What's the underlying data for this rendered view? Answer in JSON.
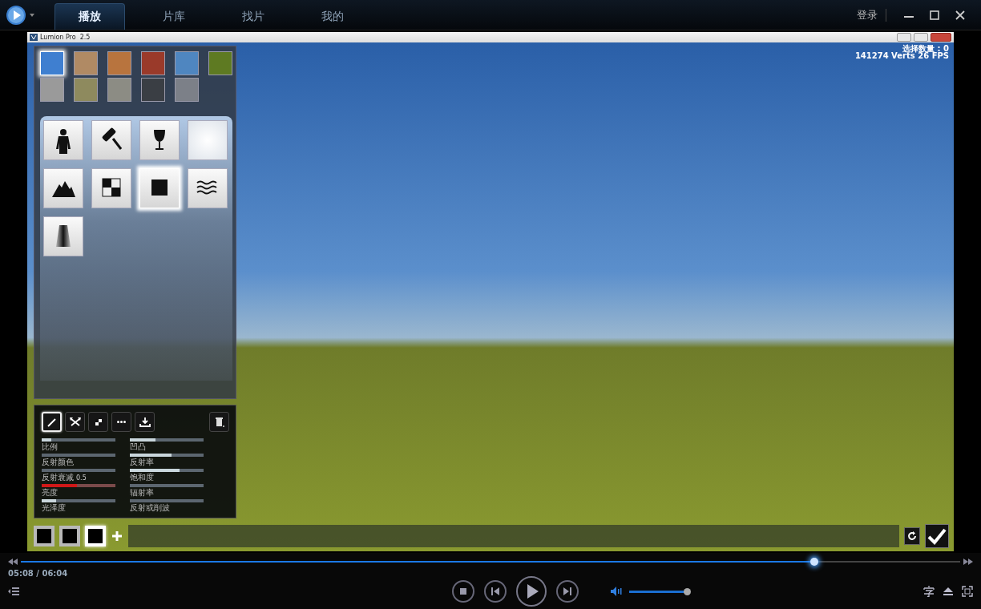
{
  "player": {
    "tabs": [
      {
        "label": "播放",
        "selected": true
      },
      {
        "label": "片库",
        "selected": false
      },
      {
        "label": "找片",
        "selected": false
      },
      {
        "label": "我的",
        "selected": false
      }
    ],
    "login": "登录"
  },
  "lumion": {
    "title": "Lumion Pro  2.5",
    "stats": [
      "选择数量 : 0",
      "141274 Verts 26 FPS"
    ],
    "textures": [
      {
        "color": "#3f7fd0",
        "selected": true
      },
      {
        "color": "#b08a64",
        "selected": false
      },
      {
        "color": "#b8743e",
        "selected": false
      },
      {
        "color": "#9a3a2a",
        "selected": false
      },
      {
        "color": "#4f86c0",
        "selected": false
      },
      {
        "color": "#5e7a22",
        "selected": false
      },
      {
        "color": "#9a9a9a",
        "selected": false
      },
      {
        "color": "#8e8a5e",
        "selected": false
      },
      {
        "color": "#8c8c84",
        "selected": false
      },
      {
        "color": "#3a3e44",
        "selected": false
      },
      {
        "color": "#7c8088",
        "selected": false
      }
    ],
    "material_types": [
      {
        "kind": "person",
        "selected": false
      },
      {
        "kind": "roller",
        "selected": false
      },
      {
        "kind": "goblet",
        "selected": false
      },
      {
        "kind": "glow",
        "selected": false
      },
      {
        "kind": "mountains",
        "selected": false
      },
      {
        "kind": "checker",
        "selected": false
      },
      {
        "kind": "square",
        "selected": true
      },
      {
        "kind": "waves",
        "selected": false
      },
      {
        "kind": "fade",
        "selected": false
      }
    ],
    "tools": [
      {
        "kind": "pencil",
        "selected": true
      },
      {
        "kind": "arrows",
        "selected": false
      },
      {
        "kind": "checker",
        "selected": false
      },
      {
        "kind": "dots",
        "selected": false
      },
      {
        "kind": "download",
        "selected": false
      }
    ],
    "sliders": [
      {
        "label": "比例",
        "level": 0.13,
        "active": false
      },
      {
        "label": "凹凸",
        "level": 0.35,
        "active": false
      },
      {
        "label": "反射颜色",
        "level": 0,
        "active": false
      },
      {
        "label": "反射率",
        "level": 0.56,
        "active": false
      },
      {
        "label": "反射衰减",
        "reading": "0.5",
        "level": 0,
        "active": false
      },
      {
        "label": "饱和度",
        "level": 0.67,
        "active": false
      },
      {
        "label": "亮度",
        "level": 0.48,
        "active": true
      },
      {
        "label": "辐射率",
        "level": 0,
        "active": false
      },
      {
        "label": "光泽度",
        "level": 0.2,
        "active": false
      },
      {
        "label": "反射或削波",
        "level": 0,
        "active": false
      }
    ],
    "slots": [
      {
        "selected": false
      },
      {
        "selected": false
      },
      {
        "selected": true
      }
    ]
  },
  "playback": {
    "progress": {
      "level": 0.845
    },
    "time": "05:08 / 06:04",
    "volume": {
      "level": 1
    }
  }
}
